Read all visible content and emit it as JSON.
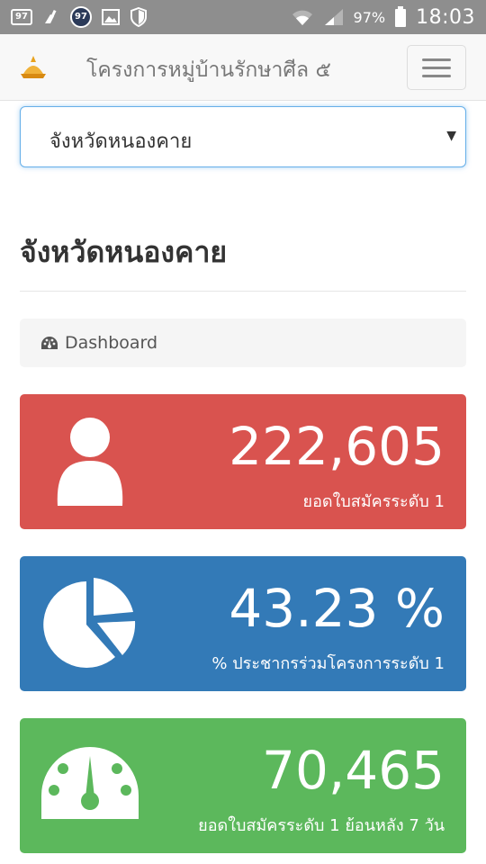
{
  "status_bar": {
    "icon_97_box": "97",
    "icon_97_circle": "97",
    "battery": "97%",
    "time": "18:03"
  },
  "navbar": {
    "title": "โครงการหมู่บ้านรักษาศีล ๕",
    "logo_icon": "stupa-logo",
    "toggle_icon": "hamburger-menu-icon"
  },
  "province_select": {
    "selected": "จังหวัดหนองคาย"
  },
  "page": {
    "heading": "จังหวัดหนองคาย"
  },
  "breadcrumb": {
    "icon": "dashboard-icon",
    "label": "Dashboard"
  },
  "panels": [
    {
      "value": "222,605",
      "label": "ยอดใบสมัครระดับ 1",
      "icon": "user-icon",
      "color": "#d9534f"
    },
    {
      "value": "43.23 %",
      "label": "% ประชากรร่วมโครงการระดับ 1",
      "icon": "pie-chart-icon",
      "color": "#337ab7"
    },
    {
      "value": "70,465",
      "label": "ยอดใบสมัครระดับ 1 ย้อนหลัง 7 วัน",
      "icon": "speedometer-icon",
      "color": "#5cb85c"
    }
  ]
}
